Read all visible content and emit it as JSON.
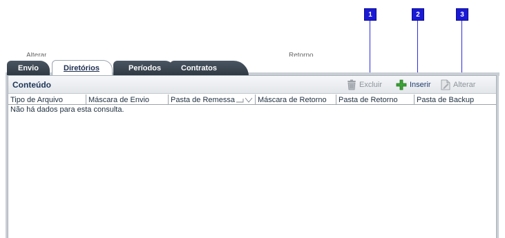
{
  "markers": [
    "1",
    "2",
    "3"
  ],
  "cut_text": [
    "Alterar",
    "Retorno"
  ],
  "tabs": [
    {
      "label": "Envio",
      "active": false
    },
    {
      "label": "Diretórios",
      "active": true
    },
    {
      "label": "Períodos",
      "active": false
    },
    {
      "label": "Contratos",
      "active": false
    }
  ],
  "panel": {
    "title": "Conteúdo",
    "actions": {
      "excluir": {
        "label": "Excluir",
        "icon": "trash-icon",
        "enabled": false
      },
      "inserir": {
        "label": "Inserir",
        "icon": "plus-icon",
        "enabled": true
      },
      "alterar": {
        "label": "Alterar",
        "icon": "document-edit-icon",
        "enabled": false
      }
    }
  },
  "grid": {
    "columns": [
      "Tipo de Arquivo",
      "Máscara de Envio",
      "Pasta de Remessa",
      "Máscara de Retorno",
      "Pasta de Retorno",
      "Pasta de Backup"
    ],
    "sorted_column": "Pasta de Remessa",
    "empty_message": "Não há dados para esta consulta."
  },
  "colors": {
    "marker": "#1a1ad6",
    "tab_dark": "#333d47",
    "frame": "#c9ced4",
    "insert_green": "#3aa236"
  }
}
